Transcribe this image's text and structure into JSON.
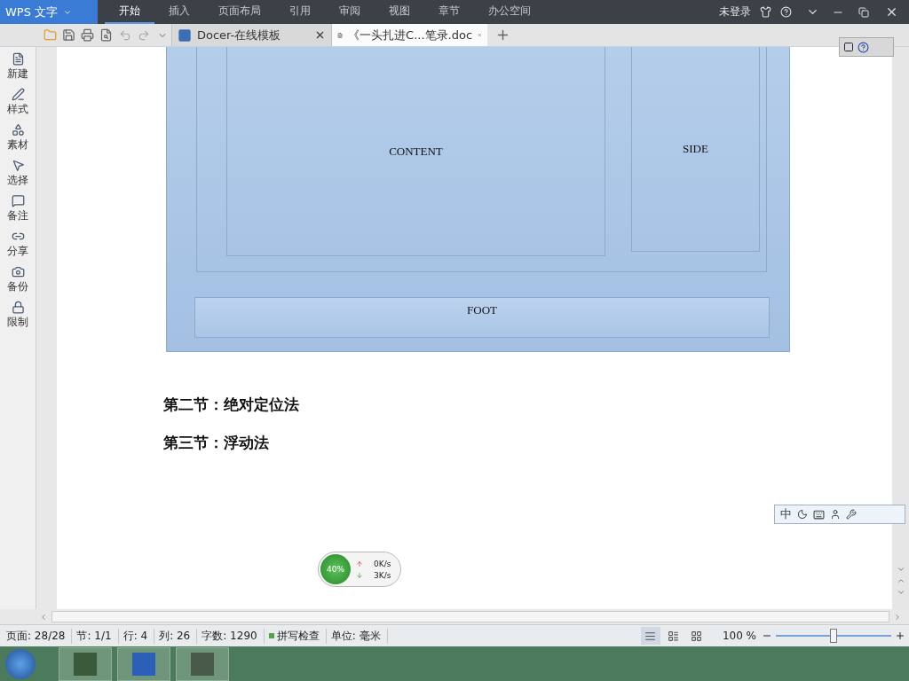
{
  "app": {
    "title": "WPS 文字",
    "account": "未登录"
  },
  "menu": [
    {
      "label": "开始",
      "selected": true
    },
    {
      "label": "插入",
      "selected": false
    },
    {
      "label": "页面布局",
      "selected": false
    },
    {
      "label": "引用",
      "selected": false
    },
    {
      "label": "审阅",
      "selected": false
    },
    {
      "label": "视图",
      "selected": false
    },
    {
      "label": "章节",
      "selected": false
    },
    {
      "label": "办公空间",
      "selected": false
    }
  ],
  "doc_tabs": [
    {
      "label": "Docer-在线模板",
      "kind": "docer",
      "selected": false
    },
    {
      "label": "《一头扎进C...笔录.doc",
      "kind": "doc",
      "selected": true
    }
  ],
  "sidebar": {
    "items": [
      {
        "label": "新建",
        "kind": "new"
      },
      {
        "label": "样式",
        "kind": "style"
      },
      {
        "label": "素材",
        "kind": "shapes"
      },
      {
        "label": "选择",
        "kind": "select"
      },
      {
        "label": "备注",
        "kind": "note"
      },
      {
        "label": "分享",
        "kind": "link"
      },
      {
        "label": "备份",
        "kind": "backup"
      },
      {
        "label": "限制",
        "kind": "lock"
      }
    ]
  },
  "document": {
    "diagram": {
      "content": "CONTENT",
      "side": "SIDE",
      "foot": "FOOT"
    },
    "headings": [
      "第二节：绝对定位法",
      "第三节：浮动法"
    ]
  },
  "ime_toolbar": {
    "mode": "中"
  },
  "speed_widget": {
    "percent": "40%",
    "up": "0K/s",
    "down": "3K/s"
  },
  "status_bar": {
    "items": [
      "页面: 28/28",
      "节: 1/1",
      "行: 4",
      "列: 26",
      "字数: 1290",
      "拼写检查",
      "单位: 毫米"
    ],
    "zoom": "100 %",
    "level": 0.5
  }
}
